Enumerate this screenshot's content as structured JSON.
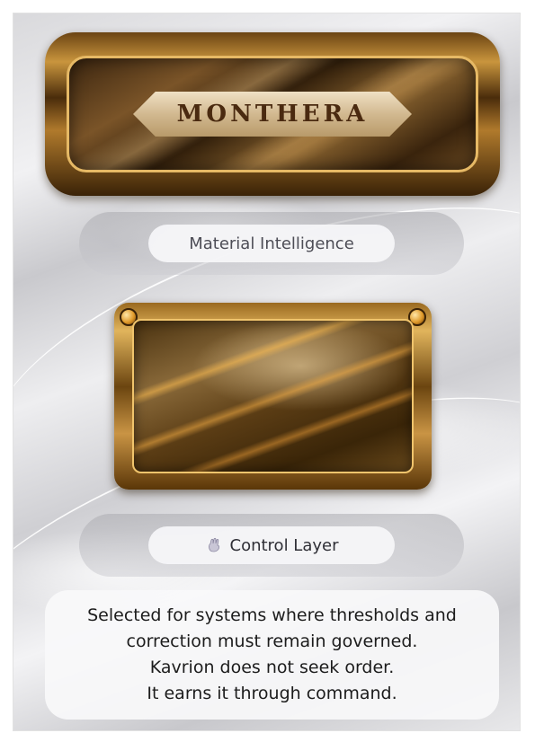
{
  "logo": {
    "title": "MONTHERA"
  },
  "label1": {
    "text": "Material Intelligence"
  },
  "label2": {
    "text": "Control Layer",
    "icon": "hand-icon"
  },
  "description": {
    "lines": [
      "Selected for systems where thresholds and",
      "correction must remain governed.",
      "Kavrion does not seek order.",
      "It earns it through command."
    ]
  },
  "colors": {
    "gold": "#c9953d",
    "text": "#1c1c1c"
  }
}
